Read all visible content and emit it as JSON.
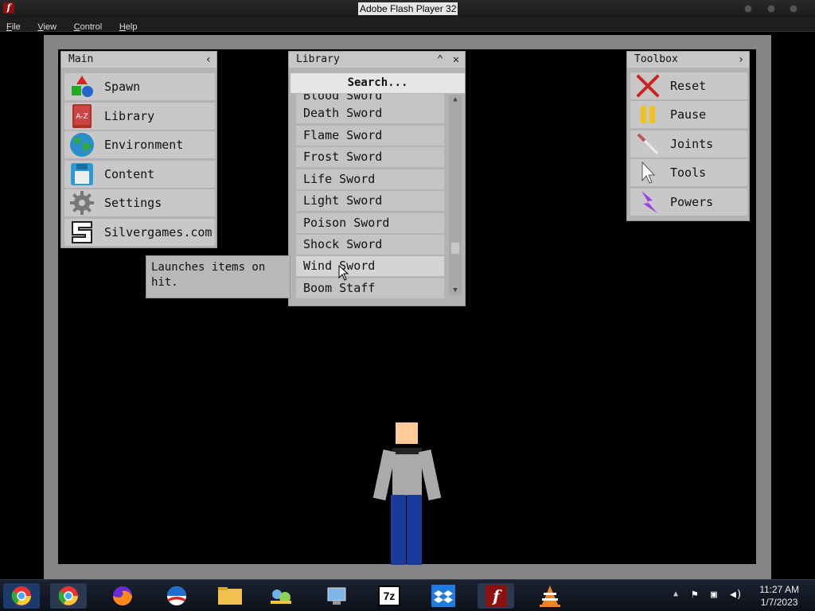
{
  "window": {
    "title": "Adobe Flash Player 32"
  },
  "menu": [
    "File",
    "View",
    "Control",
    "Help"
  ],
  "main_panel": {
    "title": "Main",
    "items": [
      {
        "label": "Spawn",
        "icon": "shapes-icon"
      },
      {
        "label": "Library",
        "icon": "book-icon"
      },
      {
        "label": "Environment",
        "icon": "globe-icon"
      },
      {
        "label": "Content",
        "icon": "floppy-icon"
      },
      {
        "label": "Settings",
        "icon": "gear-icon"
      },
      {
        "label": "Silvergames.com",
        "icon": "silvergames-logo-icon"
      }
    ]
  },
  "library_panel": {
    "title": "Library",
    "search_label": "Search...",
    "items": [
      "Blood Sword",
      "Death Sword",
      "Flame Sword",
      "Frost Sword",
      "Life Sword",
      "Light Sword",
      "Poison Sword",
      "Shock Sword",
      "Wind Sword",
      "Boom Staff"
    ],
    "hovered": "Wind Sword"
  },
  "tooltip": {
    "text": "Launches items on hit."
  },
  "toolbox_panel": {
    "title": "Toolbox",
    "items": [
      {
        "label": "Reset",
        "icon": "x-icon"
      },
      {
        "label": "Pause",
        "icon": "pause-icon"
      },
      {
        "label": "Joints",
        "icon": "needle-icon"
      },
      {
        "label": "Tools",
        "icon": "cursor-icon"
      },
      {
        "label": "Powers",
        "icon": "lightning-icon"
      }
    ]
  },
  "taskbar": {
    "time": "11:27 AM",
    "date": "1/7/2023",
    "apps": [
      "chrome-icon",
      "chrome-icon",
      "firefox-icon",
      "browser-icon",
      "file-explorer-icon",
      "network-icon",
      "system-icon",
      "7zip-icon",
      "dropbox-icon",
      "flash-player-icon",
      "vlc-icon"
    ],
    "seven_zip_label": "7z"
  },
  "colors": {
    "panel": "#b3b3b3",
    "item": "#c8c8c8",
    "frame": "#858585"
  }
}
